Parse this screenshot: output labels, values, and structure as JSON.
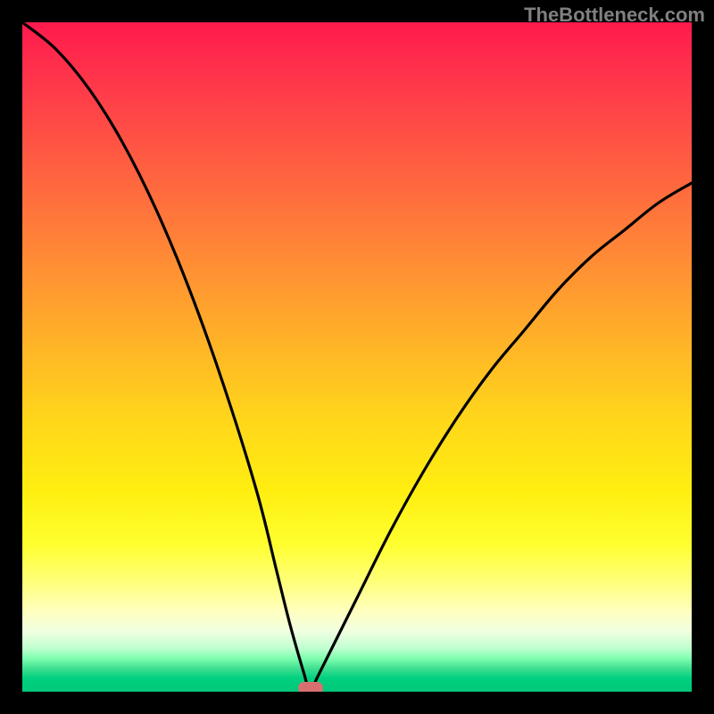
{
  "watermark": "TheBottleneck.com",
  "colors": {
    "background": "#000000",
    "curve": "#000000",
    "marker": "#d97070",
    "gradient_top": "#ff1a4d",
    "gradient_bottom": "#00c878"
  },
  "chart_data": {
    "type": "line",
    "title": "",
    "xlabel": "",
    "ylabel": "",
    "xlim": [
      0,
      100
    ],
    "ylim": [
      0,
      100
    ],
    "description": "V-shaped bottleneck curve on red-to-green vertical gradient background. Minimum near x≈43 at y≈0. Left branch rises steeply to top-left corner; right branch rises more gently toward upper right.",
    "series": [
      {
        "name": "bottleneck-curve",
        "x": [
          0,
          5,
          10,
          15,
          20,
          25,
          30,
          35,
          38,
          40,
          42,
          43,
          44,
          46,
          50,
          55,
          60,
          65,
          70,
          75,
          80,
          85,
          90,
          95,
          100
        ],
        "values": [
          100,
          96,
          90,
          82,
          72,
          60,
          46,
          30,
          18,
          10,
          3,
          0,
          2,
          6,
          14,
          24,
          33,
          41,
          48,
          54,
          60,
          65,
          69,
          73,
          76
        ]
      }
    ],
    "marker": {
      "x": 43,
      "y": 0
    }
  }
}
